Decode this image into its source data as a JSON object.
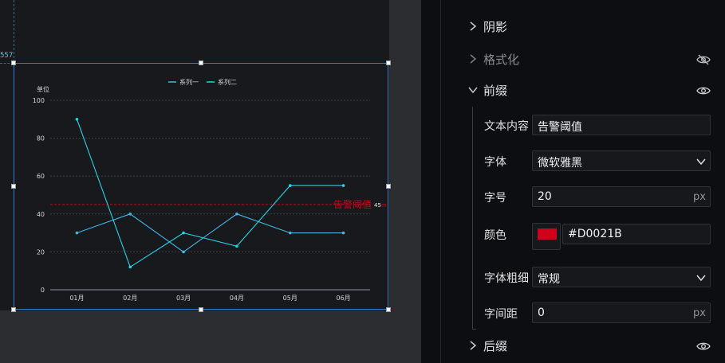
{
  "canvas": {
    "guide_readout": "557"
  },
  "chart_data": {
    "type": "line",
    "categories": [
      "01月",
      "02月",
      "03月",
      "04月",
      "05月",
      "06月"
    ],
    "series": [
      {
        "name": "系列一",
        "values": [
          30,
          40,
          20,
          40,
          30,
          30
        ],
        "color": "#3fb6e6"
      },
      {
        "name": "系列二",
        "values": [
          90,
          12,
          30,
          23,
          55,
          55
        ],
        "color": "#1fd6e8"
      }
    ],
    "ylabel": "单位",
    "ylim": [
      0,
      100
    ],
    "yticks": [
      0,
      20,
      40,
      60,
      80,
      100
    ],
    "grid": true,
    "legend_position": "top-center",
    "threshold": {
      "value": 45,
      "label": "告警阈值",
      "value_label": "45",
      "unit": "m",
      "color": "#D0021B"
    }
  },
  "panel": {
    "sections": {
      "shadow": {
        "title": "阴影",
        "expanded": false
      },
      "format": {
        "title": "格式化",
        "expanded": false,
        "visible": false
      },
      "prefix": {
        "title": "前缀",
        "expanded": true,
        "visible": true
      },
      "suffix": {
        "title": "后缀",
        "expanded": false,
        "visible": true
      }
    },
    "prefix_fields": {
      "text": {
        "label": "文本内容",
        "value": "告警阈值"
      },
      "font": {
        "label": "字体",
        "value": "微软雅黑"
      },
      "size": {
        "label": "字号",
        "value": "20",
        "unit": "px"
      },
      "color": {
        "label": "颜色",
        "value": "#D0021B",
        "swatch": "#D0021B"
      },
      "weight": {
        "label": "字体粗细",
        "value": "常规"
      },
      "spacing": {
        "label": "字间距",
        "value": "0",
        "unit": "px"
      }
    },
    "colors": {
      "accent_border": "#2f7fd1",
      "panel_bg": "#0d0e11",
      "field_bg": "#16181c"
    }
  }
}
